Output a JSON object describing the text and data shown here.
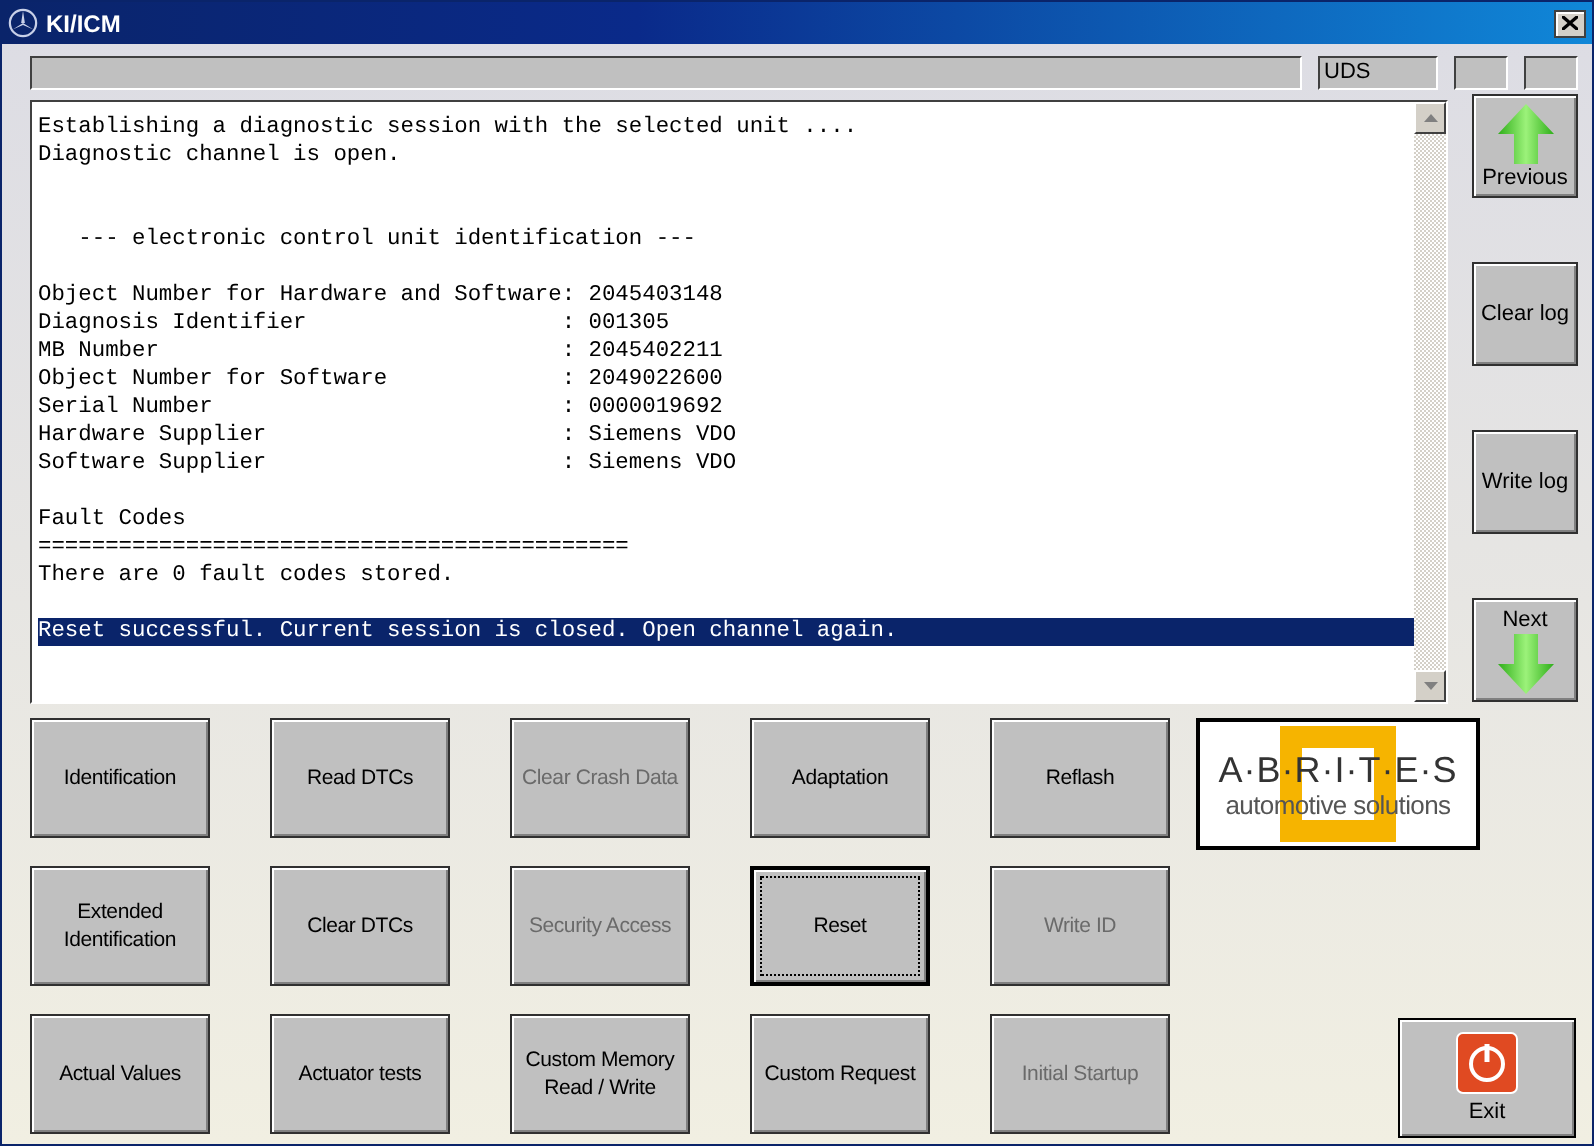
{
  "window": {
    "title": "KI/ICM"
  },
  "status_bar": {
    "protocol": "UDS"
  },
  "log": {
    "blocks": [
      {
        "kind": "text",
        "lines": [
          {
            "text": "Establishing a diagnostic session with the selected unit ....",
            "selected": false
          },
          {
            "text": "Diagnostic channel is open.",
            "selected": false
          }
        ]
      },
      {
        "kind": "heading",
        "lines": [
          {
            "text": "   --- electronic control unit identification ---",
            "selected": false
          }
        ]
      },
      {
        "kind": "text",
        "lines": [
          {
            "text": "Object Number for Hardware and Software: 2045403148",
            "selected": false
          },
          {
            "text": "Diagnosis Identifier                   : 001305",
            "selected": false
          },
          {
            "text": "MB Number                              : 2045402211",
            "selected": false
          },
          {
            "text": "Object Number for Software             : 2049022600",
            "selected": false
          },
          {
            "text": "Serial Number                          : 0000019692",
            "selected": false
          },
          {
            "text": "Hardware Supplier                      : Siemens VDO",
            "selected": false
          },
          {
            "text": "Software Supplier                      : Siemens VDO",
            "selected": false
          }
        ]
      },
      {
        "kind": "text",
        "lines": [
          {
            "text": "Fault Codes",
            "selected": false
          },
          {
            "text": "============================================",
            "selected": false
          },
          {
            "text": "There are 0 fault codes stored.",
            "selected": false
          }
        ]
      },
      {
        "kind": "text",
        "lines": [
          {
            "text": "Reset successful. Current session is closed. Open channel again.",
            "selected": true
          }
        ]
      }
    ]
  },
  "nav_buttons": [
    {
      "label": "Previous",
      "kind": "up"
    },
    {
      "label": "Clear log",
      "kind": "plain"
    },
    {
      "label": "Write log",
      "kind": "plain"
    },
    {
      "label": "Next",
      "kind": "down"
    }
  ],
  "function_buttons": [
    {
      "label": "Identification",
      "disabled": false,
      "focused": false
    },
    {
      "label": "Read DTCs",
      "disabled": false,
      "focused": false
    },
    {
      "label": "Clear Crash Data",
      "disabled": true,
      "focused": false
    },
    {
      "label": "Adaptation",
      "disabled": false,
      "focused": false
    },
    {
      "label": "Reflash",
      "disabled": false,
      "focused": false
    },
    {
      "label": "Extended Identification",
      "disabled": false,
      "focused": false
    },
    {
      "label": "Clear DTCs",
      "disabled": false,
      "focused": false
    },
    {
      "label": "Security Access",
      "disabled": true,
      "focused": false
    },
    {
      "label": "Reset",
      "disabled": false,
      "focused": true
    },
    {
      "label": "Write ID",
      "disabled": true,
      "focused": false
    },
    {
      "label": "Actual Values",
      "disabled": false,
      "focused": false
    },
    {
      "label": "Actuator tests",
      "disabled": false,
      "focused": false
    },
    {
      "label": "Custom Memory Read / Write",
      "disabled": false,
      "focused": false
    },
    {
      "label": "Custom Request",
      "disabled": false,
      "focused": false
    },
    {
      "label": "Initial Startup",
      "disabled": true,
      "focused": false
    }
  ],
  "logo": {
    "wordmark": "A·B·R·I·T·E·S",
    "tagline": "automotive solutions"
  },
  "exit_button": {
    "label": "Exit"
  }
}
